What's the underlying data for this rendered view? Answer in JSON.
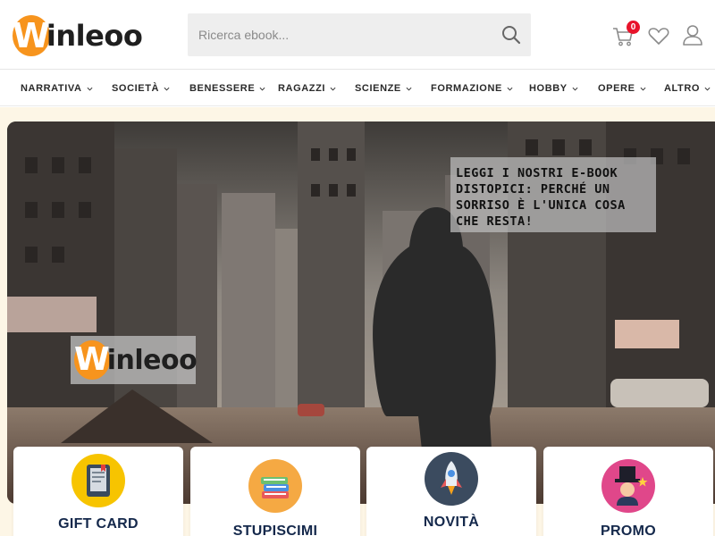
{
  "brand": {
    "logo_letter": "W",
    "logo_rest": "inleoo",
    "accent": "#f7941d"
  },
  "search": {
    "placeholder": "Ricerca ebook..."
  },
  "header_icons": {
    "cart": "cart-icon",
    "cart_count": "0",
    "wishlist": "heart-icon",
    "account": "user-icon"
  },
  "nav": {
    "items": [
      {
        "label": "NARRATIVA"
      },
      {
        "label": "SOCIETÀ"
      },
      {
        "label": "BENESSERE"
      },
      {
        "label": "RAGAZZI"
      },
      {
        "label": "SCIENZE"
      },
      {
        "label": "FORMAZIONE"
      },
      {
        "label": "HOBBY"
      },
      {
        "label": "OPERE"
      },
      {
        "label": "ALTRO"
      }
    ]
  },
  "hero": {
    "caption": "Leggi i nostri e-book distopici: perché un sorriso è l'unica cosa che resta!",
    "logo_letter": "W",
    "logo_rest": "inleoo"
  },
  "cards": [
    {
      "label": "GIFT CARD",
      "icon": "ebook-reader-icon"
    },
    {
      "label": "STUPISCIMI",
      "icon": "books-stack-icon"
    },
    {
      "label": "NOVITÀ",
      "icon": "rocket-icon"
    },
    {
      "label": "PROMO",
      "icon": "magician-icon"
    }
  ]
}
